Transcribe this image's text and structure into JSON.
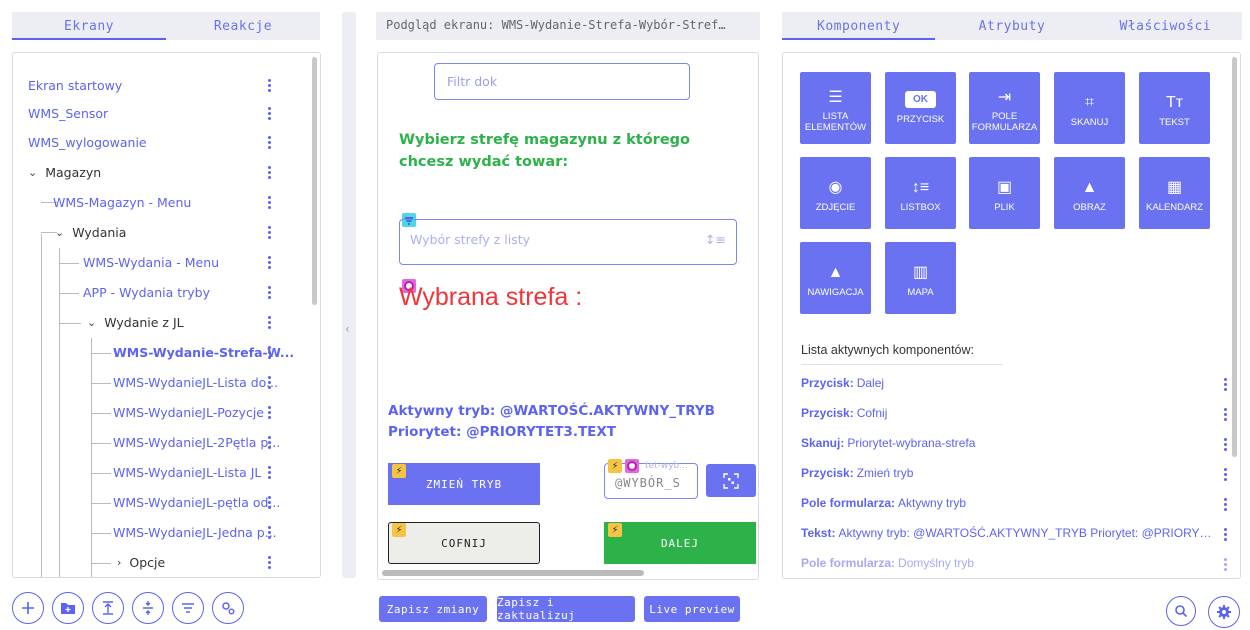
{
  "left_tabs": [
    "Ekrany",
    "Reakcje"
  ],
  "tree": [
    {
      "label": "Ekran startowy"
    },
    {
      "label": "WMS_Sensor"
    },
    {
      "label": "WMS_wylogowanie"
    },
    {
      "label": "Magazyn"
    },
    {
      "label": "WMS-Magazyn - Menu"
    },
    {
      "label": "Wydania"
    },
    {
      "label": "WMS-Wydania - Menu"
    },
    {
      "label": "APP - Wydania tryby"
    },
    {
      "label": "Wydanie z JL"
    },
    {
      "label": "WMS-Wydanie-Strefa-W..."
    },
    {
      "label": "WMS-WydanieJL-Lista do..."
    },
    {
      "label": "WMS-WydanieJL-Pozycje"
    },
    {
      "label": "WMS-WydanieJL-2Pętla p..."
    },
    {
      "label": "WMS-WydanieJL-Lista JL"
    },
    {
      "label": "WMS-WydanieJL-pętla od..."
    },
    {
      "label": "WMS-WydanieJL-Jedna p..."
    },
    {
      "label": "Opcje"
    }
  ],
  "preview": {
    "title": "Podgląd ekranu: WMS-Wydanie-Strefa-Wybór-Stref…",
    "filter_placeholder": "Filtr dok",
    "heading": "Wybierz strefę magazynu z którego chcesz wydać towar:",
    "select_placeholder": "Wybór strefy z listy",
    "selected_zone": "Wybrana strefa :",
    "mode_line": "Aktywny tryb: @WARTOŚĆ.AKTYWNY_TRYB",
    "priority_line": "Priorytet: @PRIORYTET3.TEXT",
    "btn_change_mode": "ZMIEŃ TRYB",
    "small_label": "tet-wyb...",
    "scan_value": "@WYBÓR_S",
    "btn_back": "COFNIJ",
    "btn_next": "DALEJ"
  },
  "bottom_buttons": [
    "Zapisz zmiany",
    "Zapisz i zaktualizuj",
    "Live preview"
  ],
  "right_tabs": [
    "Komponenty",
    "Atrybuty",
    "Właściwości"
  ],
  "components": [
    {
      "label": "LISTA ELEMENTÓW",
      "icon": "list-icon"
    },
    {
      "label": "PRZYCISK",
      "icon": "ok-button-icon",
      "badge": "OK"
    },
    {
      "label": "POLE FORMULARZA",
      "icon": "input-icon"
    },
    {
      "label": "SKANUJ",
      "icon": "qr-icon"
    },
    {
      "label": "TEKST",
      "icon": "text-icon",
      "glyph": "Tт"
    },
    {
      "label": "ZDJĘCIE",
      "icon": "camera-icon"
    },
    {
      "label": "LISTBOX",
      "icon": "listbox-icon"
    },
    {
      "label": "PLIK",
      "icon": "file-icon"
    },
    {
      "label": "OBRAZ",
      "icon": "image-icon"
    },
    {
      "label": "KALENDARZ",
      "icon": "calendar-icon"
    },
    {
      "label": "NAWIGACJA",
      "icon": "navigation-icon"
    },
    {
      "label": "MAPA",
      "icon": "map-icon"
    }
  ],
  "active_title": "Lista aktywnych komponentów:",
  "active": [
    {
      "type": "Przycisk:",
      "name": "Dalej"
    },
    {
      "type": "Przycisk:",
      "name": "Cofnij"
    },
    {
      "type": "Skanuj:",
      "name": "Priorytet-wybrana-strefa"
    },
    {
      "type": "Przycisk:",
      "name": "Zmień tryb"
    },
    {
      "type": "Pole formularza:",
      "name": "Aktywny tryb"
    },
    {
      "type": "Tekst:",
      "name": "Aktywny tryb: @WARTOŚĆ.AKTYWNY_TRYB Priorytet: @PRIORY…"
    },
    {
      "type": "Pole formularza:",
      "name": "Domyślny tryb"
    }
  ],
  "colors": {
    "accent": "#5b63f0",
    "green": "#2db24a",
    "red": "#f0353a",
    "bolt": "#f6c445"
  }
}
